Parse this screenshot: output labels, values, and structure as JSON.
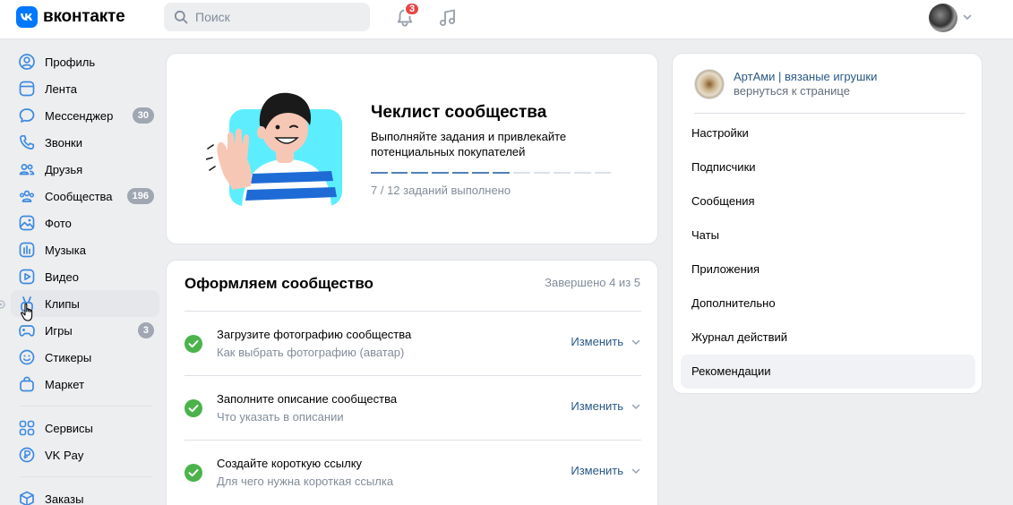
{
  "header": {
    "logo_text": "вконтакте",
    "search_placeholder": "Поиск",
    "notifications_count": "3"
  },
  "sidebar": {
    "items": [
      {
        "label": "Профиль",
        "icon": "user-circle-icon"
      },
      {
        "label": "Лента",
        "icon": "feed-icon"
      },
      {
        "label": "Мессенджер",
        "icon": "message-icon",
        "count": "30"
      },
      {
        "label": "Звонки",
        "icon": "phone-icon"
      },
      {
        "label": "Друзья",
        "icon": "friends-icon"
      },
      {
        "label": "Сообщества",
        "icon": "communities-icon",
        "count": "196"
      },
      {
        "label": "Фото",
        "icon": "photo-icon"
      },
      {
        "label": "Музыка",
        "icon": "music-bars-icon"
      },
      {
        "label": "Видео",
        "icon": "video-icon"
      },
      {
        "label": "Клипы",
        "icon": "clips-icon"
      },
      {
        "label": "Игры",
        "icon": "gamepad-icon",
        "count": "3"
      },
      {
        "label": "Стикеры",
        "icon": "smile-icon"
      },
      {
        "label": "Маркет",
        "icon": "bag-icon"
      }
    ],
    "items2": [
      {
        "label": "Сервисы",
        "icon": "services-icon"
      },
      {
        "label": "VK Pay",
        "icon": "vkpay-icon"
      }
    ],
    "items3": [
      {
        "label": "Заказы",
        "icon": "box-icon"
      }
    ]
  },
  "checklist": {
    "title": "Чеклист сообщества",
    "description": "Выполняйте задания и привлекайте потенциальных покупателей",
    "done": 7,
    "total": 12,
    "status": "7 / 12 заданий выполнено"
  },
  "setup": {
    "title": "Оформляем сообщество",
    "progress": "Завершено 4 из 5",
    "tasks": [
      {
        "title": "Загрузите фотографию сообщества",
        "subtitle": "Как выбрать фотографию (аватар)",
        "action": "Изменить"
      },
      {
        "title": "Заполните описание сообщества",
        "subtitle": "Что указать в описании",
        "action": "Изменить"
      },
      {
        "title": "Создайте короткую ссылку",
        "subtitle": "Для чего нужна короткая ссылка",
        "action": "Изменить"
      }
    ]
  },
  "community": {
    "name": "АртАми | вязаные игрушки",
    "back_link": "вернуться к странице",
    "menu": [
      {
        "label": "Настройки"
      },
      {
        "label": "Подписчики"
      },
      {
        "label": "Сообщения"
      },
      {
        "label": "Чаты"
      },
      {
        "label": "Приложения"
      },
      {
        "label": "Дополнительно"
      },
      {
        "label": "Журнал действий"
      },
      {
        "label": "Рекомендации",
        "active": true
      }
    ]
  },
  "colors": {
    "accent": "#0077ff",
    "link": "#2a5885",
    "check": "#4bb34b",
    "badge": "#e64646"
  }
}
